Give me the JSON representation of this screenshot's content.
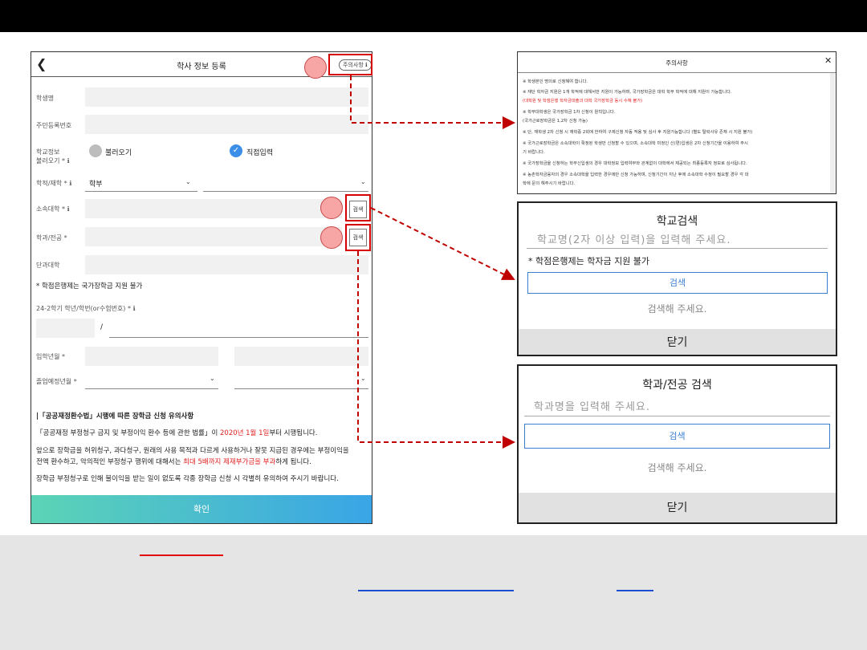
{
  "form": {
    "title": "학사 정보 등록",
    "notice_button": "주의사항 ℹ",
    "labels": {
      "name": "학생명",
      "resident_no": "주민등록번호",
      "school_info_1": "학교정보",
      "school_info_2": "불러오기 * ℹ",
      "degree": "학적/재학 * ℹ",
      "university": "소속대학 * ℹ",
      "major": "학과/전공 *",
      "college": "단과대학",
      "semester": "24-2학기 학년/학번(or수험번호) * ℹ",
      "admission": "입학년월 *",
      "graduation": "졸업예정년월 *"
    },
    "radio_load": "불러오기",
    "radio_direct": "직접입력",
    "degree_value": "학부",
    "search_button": "검색",
    "credit_bank_note": "* 학점은행제는 국가장학금 지원 불가",
    "slash": "/",
    "notice_heading": "|「공공재정환수법」시행에 따른 장학금 신청 유의사항",
    "notice_l1_a": "「공공재정 부정청구 금지 및 부정이익 환수 등에 관한 법률」이 ",
    "notice_l1_red": "2020년 1월 1일",
    "notice_l1_b": "부터 시행됩니다.",
    "notice_l2": "앞으로 장학금을 허위청구, 과다청구, 원래의 사용 목적과 다르게 사용하거나 잘못 지급된 경우에는 부정이익을",
    "notice_l3_a": "전액 환수하고, 악의적인 부정청구 행위에 대해서는 ",
    "notice_l3_red": "최대 5배까지 제재부가금을 부과",
    "notice_l3_b": "하게 됩니다.",
    "notice_l4": "장학금 부정청구로 인해 불이익을 받는 일이 없도록 각종 장학금 신청 시 각별히 유의하여 주시기 바랍니다.",
    "confirm": "확인"
  },
  "notice_panel": {
    "title": "주의사항",
    "close": "✕",
    "lines": [
      {
        "text": "※  학생본인 명의로 신청해야 합니다.",
        "red": false
      },
      {
        "text": "※  재단 학자금 지원은 1개 학적에 대해서만 지원이 가능하며, 국가장학금은 대학 학부 학적에 대해 지원이 가능합니다.",
        "red": false
      },
      {
        "text": "      (대학원 및 학점은행 학자금대출과 대학 국가장학금 동시 수혜 불가)",
        "red": true
      },
      {
        "text": "※  학부대학생은 국가장학금 1차 신청이 원칙입니다.",
        "red": false
      },
      {
        "text": "      (국가근로장학금은 1,2차 신청 가능)",
        "red": false
      },
      {
        "text": "※  단, 재학생 2차 신청 시 재학중 2회에 한하여 구제신청 자동 적용 및 심사 후 지원가능합니다 (별도 탈락사유 존재 시 지원 불가)",
        "red": false
      },
      {
        "text": "※  국가근로장학금은 소속대학이 확정된 학생만 신청할 수 있으며, 소속대학 미정인 신(편)입생은 2차 신청기간을 이용하여 주시",
        "red": false
      },
      {
        "text": "      기 바랍니다.",
        "red": false
      },
      {
        "text": "※  국가장학금을 신청하는 학부신입생의 경우 대학정보 입력여부와 관계없이 대학에서 제공되는 최종등록자 정보로 심사됩니다.",
        "red": false
      },
      {
        "text": "※  농촌학자금융자의 경우 소속대학을 입력한 경우에만 신청 가능하며, 신청기간이 지난 후에 소속대학 수정이 필요할 경우 각 대",
        "red": false
      },
      {
        "text": "      학에 문의 해주시기 바랍니다.",
        "red": false
      }
    ]
  },
  "school_search": {
    "title": "학교검색",
    "placeholder": "학교명(2자 이상 입력)을 입력해 주세요.",
    "note": "* 학점은행제는 학자금 지원 불가",
    "button": "검색",
    "message": "검색해 주세요.",
    "close": "닫기"
  },
  "major_search": {
    "title": "학과/전공 검색",
    "placeholder": "학과명을 입력해 주세요.",
    "button": "검색",
    "message": "검색해 주세요.",
    "close": "닫기"
  },
  "colors": {
    "highlight_red": "#d60000",
    "accent_blue": "#3d8ee8",
    "confirm_gradient_start": "#5bd4b6",
    "confirm_gradient_end": "#3aa5e6"
  }
}
